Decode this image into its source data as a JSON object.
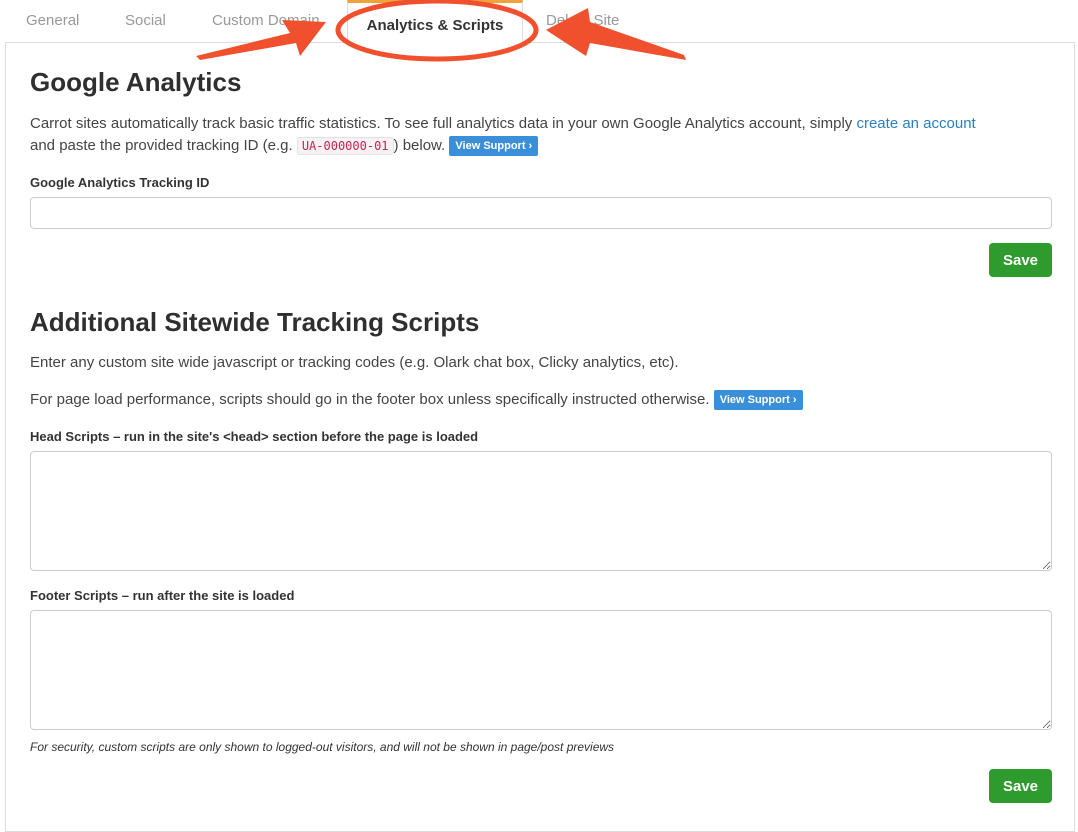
{
  "tabs": [
    {
      "label": "General"
    },
    {
      "label": "Social"
    },
    {
      "label": "Custom Domain"
    },
    {
      "label": "Analytics & Scripts",
      "active": true
    },
    {
      "label": "Delete Site"
    }
  ],
  "ga": {
    "title": "Google Analytics",
    "desc_part1": "Carrot sites automatically track basic traffic statistics. To see full analytics data in your own Google Analytics account, simply ",
    "desc_link": "create an account",
    "desc_part2": "and paste the provided tracking ID (e.g. ",
    "code_example": "UA-000000-01",
    "desc_part3": ") below.",
    "support_label": "View Support ›",
    "field_label": "Google Analytics Tracking ID",
    "field_value": "",
    "save_label": "Save"
  },
  "scripts": {
    "title": "Additional Sitewide Tracking Scripts",
    "desc1": "Enter any custom site wide javascript or tracking codes (e.g. Olark chat box, Clicky analytics, etc).",
    "desc2": "For page load performance, scripts should go in the footer box unless specifically instructed otherwise.",
    "support_label": "View Support ›",
    "head_label": "Head Scripts – run in the site's <head> section before the page is loaded",
    "head_value": "",
    "footer_label": "Footer Scripts – run after the site is loaded",
    "footer_value": "",
    "security_note": "For security, custom scripts are only shown to logged-out visitors, and will not be shown in page/post previews",
    "save_label": "Save"
  },
  "colors": {
    "accent_tab": "#f0a23b",
    "link": "#2a7fc1",
    "support_button": "#3a8fd8",
    "save_button": "#2e9b2e",
    "annotation": "#f0502d"
  }
}
